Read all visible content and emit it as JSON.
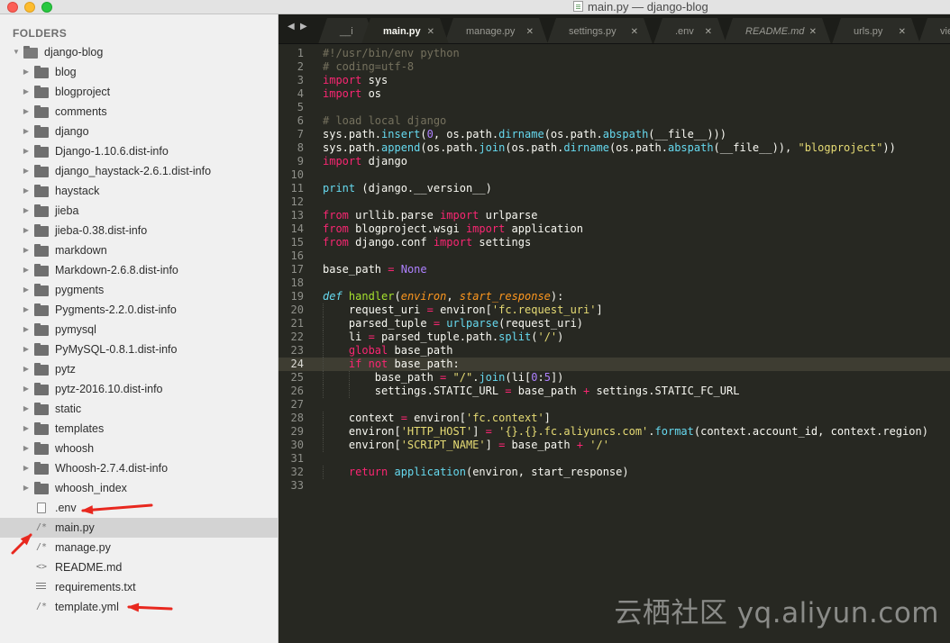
{
  "window": {
    "title": "main.py — django-blog"
  },
  "sidebar": {
    "heading": "FOLDERS",
    "root": "django-blog",
    "folders": [
      "blog",
      "blogproject",
      "comments",
      "django",
      "Django-1.10.6.dist-info",
      "django_haystack-2.6.1.dist-info",
      "haystack",
      "jieba",
      "jieba-0.38.dist-info",
      "markdown",
      "Markdown-2.6.8.dist-info",
      "pygments",
      "Pygments-2.2.0.dist-info",
      "pymysql",
      "PyMySQL-0.8.1.dist-info",
      "pytz",
      "pytz-2016.10.dist-info",
      "static",
      "templates",
      "whoosh",
      "Whoosh-2.7.4.dist-info",
      "whoosh_index"
    ],
    "files": [
      {
        "name": ".env",
        "icon": "file-icon"
      },
      {
        "name": "main.py",
        "icon": "python-icon",
        "selected": true
      },
      {
        "name": "manage.py",
        "icon": "python-icon"
      },
      {
        "name": "README.md",
        "icon": "markdown-icon"
      },
      {
        "name": "requirements.txt",
        "icon": "text-icon"
      },
      {
        "name": "template.yml",
        "icon": "python-icon"
      }
    ]
  },
  "tabs": [
    {
      "label": "__i",
      "active": false
    },
    {
      "label": "main.py",
      "active": true
    },
    {
      "label": "manage.py",
      "active": false
    },
    {
      "label": "settings.py",
      "active": false
    },
    {
      "label": ".env",
      "active": false
    },
    {
      "label": "README.md",
      "active": false
    },
    {
      "label": "urls.py",
      "active": false
    },
    {
      "label": "vie",
      "active": false
    }
  ],
  "tab_nav": {
    "prev": "◀",
    "next": "▶"
  },
  "editor": {
    "current_line": 24,
    "theme": {
      "background": "#272822",
      "comment": "#75715e",
      "keyword": "#f92672",
      "function": "#66d9ef",
      "string": "#e6db74",
      "number": "#ae81ff",
      "param": "#fd971f"
    },
    "lines": [
      {
        "n": "1",
        "t": [
          [
            "c",
            "#!/usr/bin/env python"
          ]
        ]
      },
      {
        "n": "2",
        "t": [
          [
            "c",
            "# coding=utf-8"
          ]
        ]
      },
      {
        "n": "3",
        "t": [
          [
            "k",
            "import"
          ],
          [
            "p",
            " sys"
          ]
        ]
      },
      {
        "n": "4",
        "t": [
          [
            "k",
            "import"
          ],
          [
            "p",
            " os"
          ]
        ]
      },
      {
        "n": "5",
        "t": []
      },
      {
        "n": "6",
        "t": [
          [
            "c",
            "# load local django"
          ]
        ]
      },
      {
        "n": "7",
        "t": [
          [
            "p",
            "sys.path."
          ],
          [
            "f",
            "insert"
          ],
          [
            "p",
            "("
          ],
          [
            "num",
            "0"
          ],
          [
            "p",
            ", os.path."
          ],
          [
            "f",
            "dirname"
          ],
          [
            "p",
            "(os.path."
          ],
          [
            "f",
            "abspath"
          ],
          [
            "p",
            "(__file__)))"
          ]
        ]
      },
      {
        "n": "8",
        "t": [
          [
            "p",
            "sys.path."
          ],
          [
            "f",
            "append"
          ],
          [
            "p",
            "(os.path."
          ],
          [
            "f",
            "join"
          ],
          [
            "p",
            "(os.path."
          ],
          [
            "f",
            "dirname"
          ],
          [
            "p",
            "(os.path."
          ],
          [
            "f",
            "abspath"
          ],
          [
            "p",
            "(__file__)), "
          ],
          [
            "s",
            "\"blogproject\""
          ],
          [
            "p",
            "))"
          ]
        ]
      },
      {
        "n": "9",
        "t": [
          [
            "k",
            "import"
          ],
          [
            "p",
            " django"
          ]
        ]
      },
      {
        "n": "10",
        "t": []
      },
      {
        "n": "11",
        "t": [
          [
            "f",
            "print"
          ],
          [
            "p",
            " (django.__version__)"
          ]
        ]
      },
      {
        "n": "12",
        "t": []
      },
      {
        "n": "13",
        "t": [
          [
            "k",
            "from"
          ],
          [
            "p",
            " urllib.parse "
          ],
          [
            "k",
            "import"
          ],
          [
            "p",
            " urlparse"
          ]
        ]
      },
      {
        "n": "14",
        "t": [
          [
            "k",
            "from"
          ],
          [
            "p",
            " blogproject.wsgi "
          ],
          [
            "k",
            "import"
          ],
          [
            "p",
            " application"
          ]
        ]
      },
      {
        "n": "15",
        "t": [
          [
            "k",
            "from"
          ],
          [
            "p",
            " django.conf "
          ],
          [
            "k",
            "import"
          ],
          [
            "p",
            " settings"
          ]
        ]
      },
      {
        "n": "16",
        "t": []
      },
      {
        "n": "17",
        "t": [
          [
            "p",
            "base_path "
          ],
          [
            "k",
            "="
          ],
          [
            "p",
            " "
          ],
          [
            "num",
            "None"
          ]
        ]
      },
      {
        "n": "18",
        "t": []
      },
      {
        "n": "19",
        "t": [
          [
            "d",
            "def"
          ],
          [
            "p",
            " "
          ],
          [
            "nm",
            "handler"
          ],
          [
            "p",
            "("
          ],
          [
            "a",
            "environ"
          ],
          [
            "p",
            ", "
          ],
          [
            "a",
            "start_response"
          ],
          [
            "p",
            "):"
          ]
        ]
      },
      {
        "n": "20",
        "i": 1,
        "t": [
          [
            "p",
            "request_uri "
          ],
          [
            "k",
            "="
          ],
          [
            "p",
            " environ["
          ],
          [
            "s",
            "'fc.request_uri'"
          ],
          [
            "p",
            "]"
          ]
        ]
      },
      {
        "n": "21",
        "i": 1,
        "t": [
          [
            "p",
            "parsed_tuple "
          ],
          [
            "k",
            "="
          ],
          [
            "p",
            " "
          ],
          [
            "f",
            "urlparse"
          ],
          [
            "p",
            "(request_uri)"
          ]
        ]
      },
      {
        "n": "22",
        "i": 1,
        "t": [
          [
            "p",
            "li "
          ],
          [
            "k",
            "="
          ],
          [
            "p",
            " parsed_tuple.path."
          ],
          [
            "f",
            "split"
          ],
          [
            "p",
            "("
          ],
          [
            "s",
            "'/'"
          ],
          [
            "p",
            ")"
          ]
        ]
      },
      {
        "n": "23",
        "i": 1,
        "t": [
          [
            "k",
            "global"
          ],
          [
            "p",
            " base_path"
          ]
        ]
      },
      {
        "n": "24",
        "i": 1,
        "t": [
          [
            "k",
            "if"
          ],
          [
            "p",
            " "
          ],
          [
            "k",
            "not"
          ],
          [
            "p",
            " base_path:"
          ]
        ]
      },
      {
        "n": "25",
        "i": 2,
        "t": [
          [
            "p",
            "base_path "
          ],
          [
            "k",
            "="
          ],
          [
            "p",
            " "
          ],
          [
            "s",
            "\"/\""
          ],
          [
            "p",
            "."
          ],
          [
            "f",
            "join"
          ],
          [
            "p",
            "(li["
          ],
          [
            "num",
            "0"
          ],
          [
            "p",
            ":"
          ],
          [
            "num",
            "5"
          ],
          [
            "p",
            "])"
          ]
        ]
      },
      {
        "n": "26",
        "i": 2,
        "t": [
          [
            "p",
            "settings.STATIC_URL "
          ],
          [
            "k",
            "="
          ],
          [
            "p",
            " base_path "
          ],
          [
            "k",
            "+"
          ],
          [
            "p",
            " settings.STATIC_FC_URL"
          ]
        ]
      },
      {
        "n": "27",
        "t": []
      },
      {
        "n": "28",
        "i": 1,
        "t": [
          [
            "p",
            "context "
          ],
          [
            "k",
            "="
          ],
          [
            "p",
            " environ["
          ],
          [
            "s",
            "'fc.context'"
          ],
          [
            "p",
            "]"
          ]
        ]
      },
      {
        "n": "29",
        "i": 1,
        "t": [
          [
            "p",
            "environ["
          ],
          [
            "s",
            "'HTTP_HOST'"
          ],
          [
            "p",
            "] "
          ],
          [
            "k",
            "="
          ],
          [
            "p",
            " "
          ],
          [
            "s",
            "'{}.{}.fc.aliyuncs.com'"
          ],
          [
            "p",
            "."
          ],
          [
            "f",
            "format"
          ],
          [
            "p",
            "(context.account_id, context.region)"
          ]
        ]
      },
      {
        "n": "30",
        "i": 1,
        "t": [
          [
            "p",
            "environ["
          ],
          [
            "s",
            "'SCRIPT_NAME'"
          ],
          [
            "p",
            "] "
          ],
          [
            "k",
            "="
          ],
          [
            "p",
            " base_path "
          ],
          [
            "k",
            "+"
          ],
          [
            "p",
            " "
          ],
          [
            "s",
            "'/'"
          ]
        ]
      },
      {
        "n": "31",
        "t": []
      },
      {
        "n": "32",
        "i": 1,
        "t": [
          [
            "k",
            "return"
          ],
          [
            "p",
            " "
          ],
          [
            "f",
            "application"
          ],
          [
            "p",
            "(environ, start_response)"
          ]
        ]
      },
      {
        "n": "33",
        "t": []
      }
    ]
  },
  "watermark": "云栖社区 yq.aliyun.com",
  "annotation_color": "#e8281f"
}
